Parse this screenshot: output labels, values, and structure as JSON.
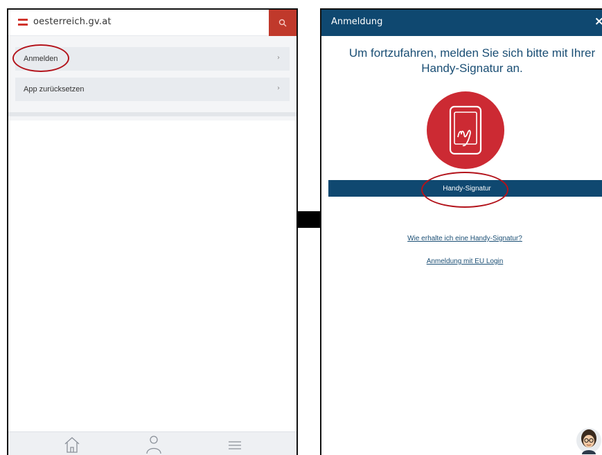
{
  "left_screen": {
    "site_name": "oesterreich.gv.at",
    "menu_items": [
      {
        "label": "Anmelden",
        "chevron": "›"
      },
      {
        "label": "App zurücksetzen",
        "chevron": "›"
      }
    ],
    "bottom_nav_icons": [
      "home-icon",
      "user-icon",
      "menu-icon"
    ]
  },
  "right_screen": {
    "header_title": "Anmeldung",
    "close_label": "×",
    "prompt": "Um fortzufahren, melden Sie sich bitte mit Ihrer Handy-Signatur an.",
    "primary_button": "Handy-Signatur",
    "links": [
      "Wie erhalte ich eine Handy-Signatur?",
      "Anmeldung mit EU Login"
    ]
  },
  "colors": {
    "header_blue": "#0f4870",
    "accent_red": "#c0392b",
    "highlight_red": "#b3131b"
  }
}
